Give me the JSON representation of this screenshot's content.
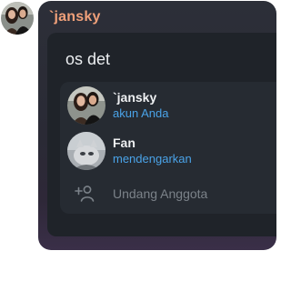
{
  "message": {
    "sender_name": "`jansky",
    "sender_avatar_icon": "profile-photo-couple"
  },
  "group_card": {
    "title": "os det",
    "members": [
      {
        "name": "`jansky",
        "status": "akun Anda",
        "avatar_icon": "profile-photo-couple"
      },
      {
        "name": "Fan",
        "status": "mendengarkan",
        "avatar_icon": "profile-photo-cat"
      }
    ],
    "invite_label": "Undang Anggota",
    "invite_icon": "add-person-icon"
  },
  "colors": {
    "sender_name": "#f0a07a",
    "status_text": "#4aa3e8",
    "card_background": "#1f2329",
    "bubble_background": "#2c2f38"
  }
}
